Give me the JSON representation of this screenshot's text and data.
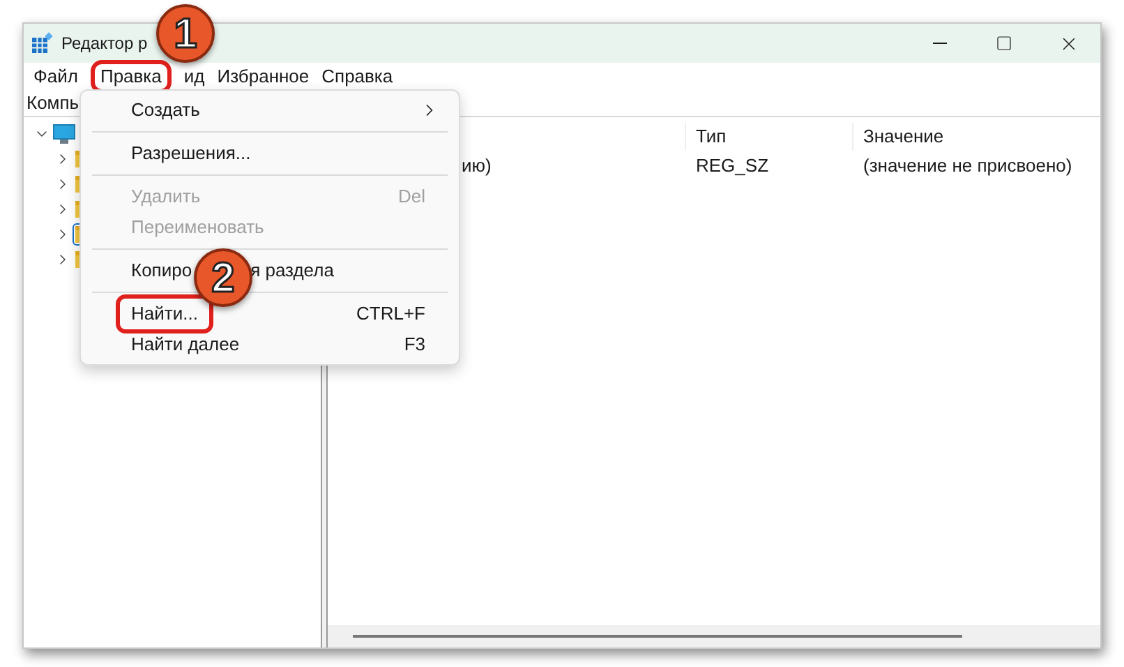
{
  "window": {
    "title": "Редактор р"
  },
  "menu_bar": [
    {
      "label": "Файл",
      "highlighted": false
    },
    {
      "label": "Правка",
      "highlighted": true
    },
    {
      "label": "ид",
      "highlighted": false
    },
    {
      "label": "Избранное",
      "highlighted": false
    },
    {
      "label": "Справка",
      "highlighted": false
    }
  ],
  "address_bar": {
    "path": "Компь"
  },
  "tree": [
    {
      "kind": "computer",
      "expanded": true,
      "children": [
        {
          "kind": "folder",
          "expanded": false,
          "selected": false
        },
        {
          "kind": "folder",
          "expanded": false,
          "selected": false
        },
        {
          "kind": "folder",
          "expanded": false,
          "selected": false
        },
        {
          "kind": "folder",
          "expanded": false,
          "selected": true
        },
        {
          "kind": "folder",
          "expanded": false,
          "selected": false
        }
      ]
    }
  ],
  "table": {
    "columns": [
      "Тип",
      "Значение"
    ],
    "rows": [
      {
        "name": "ию)",
        "type": "REG_SZ",
        "value": "(значение не присвоено)"
      }
    ]
  },
  "edit_menu": {
    "items": [
      {
        "kind": "submenu",
        "label": "Создать",
        "disabled": false,
        "highlighted": false
      },
      {
        "kind": "separator"
      },
      {
        "kind": "item",
        "label": "Разрешения...",
        "disabled": false,
        "highlighted": false
      },
      {
        "kind": "separator"
      },
      {
        "kind": "item",
        "label": "Удалить",
        "shortcut": "Del",
        "disabled": true,
        "highlighted": false
      },
      {
        "kind": "item",
        "label": "Переименовать",
        "disabled": true,
        "highlighted": false
      },
      {
        "kind": "separator"
      },
      {
        "kind": "split",
        "label": "Копиро",
        "label_tail": "я раздела",
        "disabled": false,
        "highlighted": false
      },
      {
        "kind": "separator"
      },
      {
        "kind": "item",
        "label": "Найти...",
        "shortcut": "CTRL+F",
        "disabled": false,
        "highlighted": true
      },
      {
        "kind": "item",
        "label": "Найти далее",
        "shortcut": "F3",
        "disabled": false,
        "highlighted": false
      }
    ]
  },
  "callouts": [
    "1",
    "2"
  ]
}
